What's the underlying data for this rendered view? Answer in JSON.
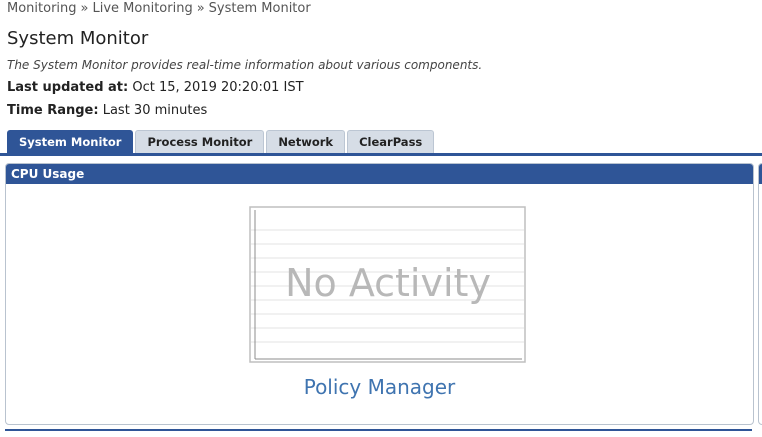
{
  "breadcrumb": {
    "items": [
      "Monitoring",
      "Live Monitoring"
    ],
    "separator": "»",
    "current": "System Monitor"
  },
  "page": {
    "title": "System Monitor",
    "description": "The System Monitor provides real-time information about various components.",
    "last_updated_label": "Last updated at:",
    "last_updated_value": "Oct 15, 2019 20:20:01 IST",
    "time_range_label": "Time Range:",
    "time_range_value": "Last 30 minutes"
  },
  "tabs": [
    {
      "label": "System Monitor",
      "active": true
    },
    {
      "label": "Process Monitor",
      "active": false
    },
    {
      "label": "Network",
      "active": false
    },
    {
      "label": "ClearPass",
      "active": false
    }
  ],
  "panel": {
    "title": "CPU Usage",
    "chart_placeholder": "No Activity",
    "chart_caption": "Policy Manager"
  },
  "colors": {
    "accent": "#2f5597",
    "tab_inactive": "#d6dde6",
    "caption": "#3f74b0",
    "placeholder_text": "#b8b8b8"
  }
}
